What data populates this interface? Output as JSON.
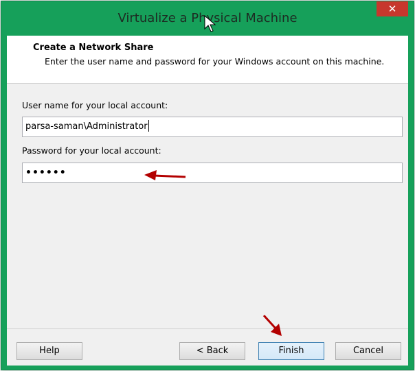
{
  "window": {
    "title": "Virtualize a Physical Machine",
    "close_glyph": "✕",
    "accent_color": "#16a05a",
    "close_color": "#c7372d"
  },
  "header": {
    "title": "Create a Network Share",
    "description": "Enter the user name and password for your Windows account on this machine."
  },
  "form": {
    "username_label": "User name for your local account:",
    "username_value": "parsa-saman\\Administrator",
    "password_label": "Password for your local account:",
    "password_value": "••••••"
  },
  "buttons": {
    "help": "Help",
    "back": "< Back",
    "finish": "Finish",
    "cancel": "Cancel"
  },
  "annotations": {
    "arrow_color": "#b30000"
  }
}
